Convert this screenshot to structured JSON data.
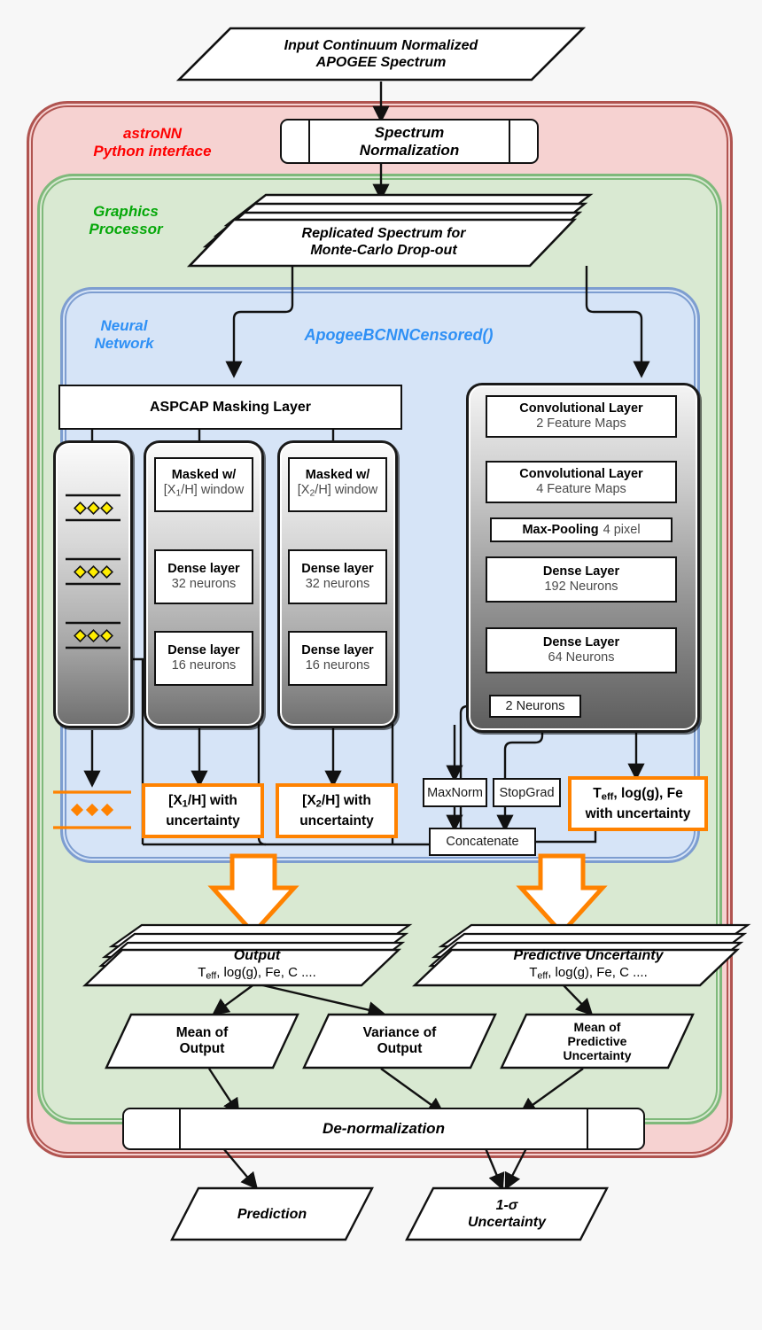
{
  "regions": {
    "astronn": {
      "label": "astroNN\nPython interface",
      "color": "#fe0000"
    },
    "gpu": {
      "label": "Graphics\nProcessor",
      "color": "#06a80a"
    },
    "nn": {
      "label": "Neural\nNetwork",
      "color": "#2f90f5"
    },
    "model_name": "ApogeeBCNNCensored()"
  },
  "input": {
    "line1": "Input Continuum Normalized",
    "line2": "APOGEE Spectrum"
  },
  "spectrum_normalization": "Spectrum\nNormalization",
  "replicated": {
    "line1": "Replicated Spectrum for",
    "line2": "Monte-Carlo Drop-out"
  },
  "masking_layer": "ASPCAP Masking Layer",
  "branches": [
    {
      "mask_l1": "Masked w/",
      "mask_l2": "[X1/H] window",
      "d1_l1": "Dense layer",
      "d1_l2": "32 neurons",
      "d2_l1": "Dense layer",
      "d2_l2": "16 neurons",
      "out_l1": "[X1/H] with",
      "out_l2": "uncertainty"
    },
    {
      "mask_l1": "Masked w/",
      "mask_l2": "[X2/H] window",
      "d1_l1": "Dense layer",
      "d1_l2": "32 neurons",
      "d2_l1": "Dense layer",
      "d2_l2": "16 neurons",
      "out_l1": "[X2/H] with",
      "out_l2": "uncertainty"
    }
  ],
  "cnn": {
    "conv1_l1": "Convolutional Layer",
    "conv1_l2": "2 Feature Maps",
    "conv2_l1": "Convolutional Layer",
    "conv2_l2": "4 Feature Maps",
    "pool_l1": "Max-Pooling",
    "pool_l2": "4 pixel",
    "dense1_l1": "Dense Layer",
    "dense1_l2": "192 Neurons",
    "dense2_l1": "Dense Layer",
    "dense2_l2": "64 Neurons",
    "neurons2": "2 Neurons",
    "out_l1": "Teff, log(g), Fe",
    "out_l2": "with uncertainty"
  },
  "ops": {
    "maxnorm": "MaxNorm",
    "stopgrad": "StopGrad",
    "concatenate": "Concatenate"
  },
  "output_stack": {
    "line1": "Output",
    "line2": "Teff, log(g), Fe, C ...."
  },
  "uncertainty_stack": {
    "line1": "Predictive Uncertainty",
    "line2": "Teff, log(g), Fe, C ...."
  },
  "aggregates": [
    {
      "l1": "Mean of",
      "l2": "Output",
      "l3": ""
    },
    {
      "l1": "Variance of",
      "l2": "Output",
      "l3": ""
    },
    {
      "l1": "Mean of",
      "l2": "Predictive",
      "l3": "Uncertainty"
    }
  ],
  "denormalization": "De-normalization",
  "final": [
    {
      "line1": "Prediction",
      "line2": ""
    },
    {
      "line1": "1-σ",
      "line2": "Uncertainty"
    }
  ],
  "colors": {
    "red_fill": "#f6d2d1",
    "red_line": "#b05450",
    "green_fill": "#d9e9d2",
    "green_line": "#7fb97b",
    "blue_fill": "#d6e4f7",
    "blue_line": "#7d9dd0",
    "orange": "#ff8200",
    "diamond": "#ffee00"
  }
}
